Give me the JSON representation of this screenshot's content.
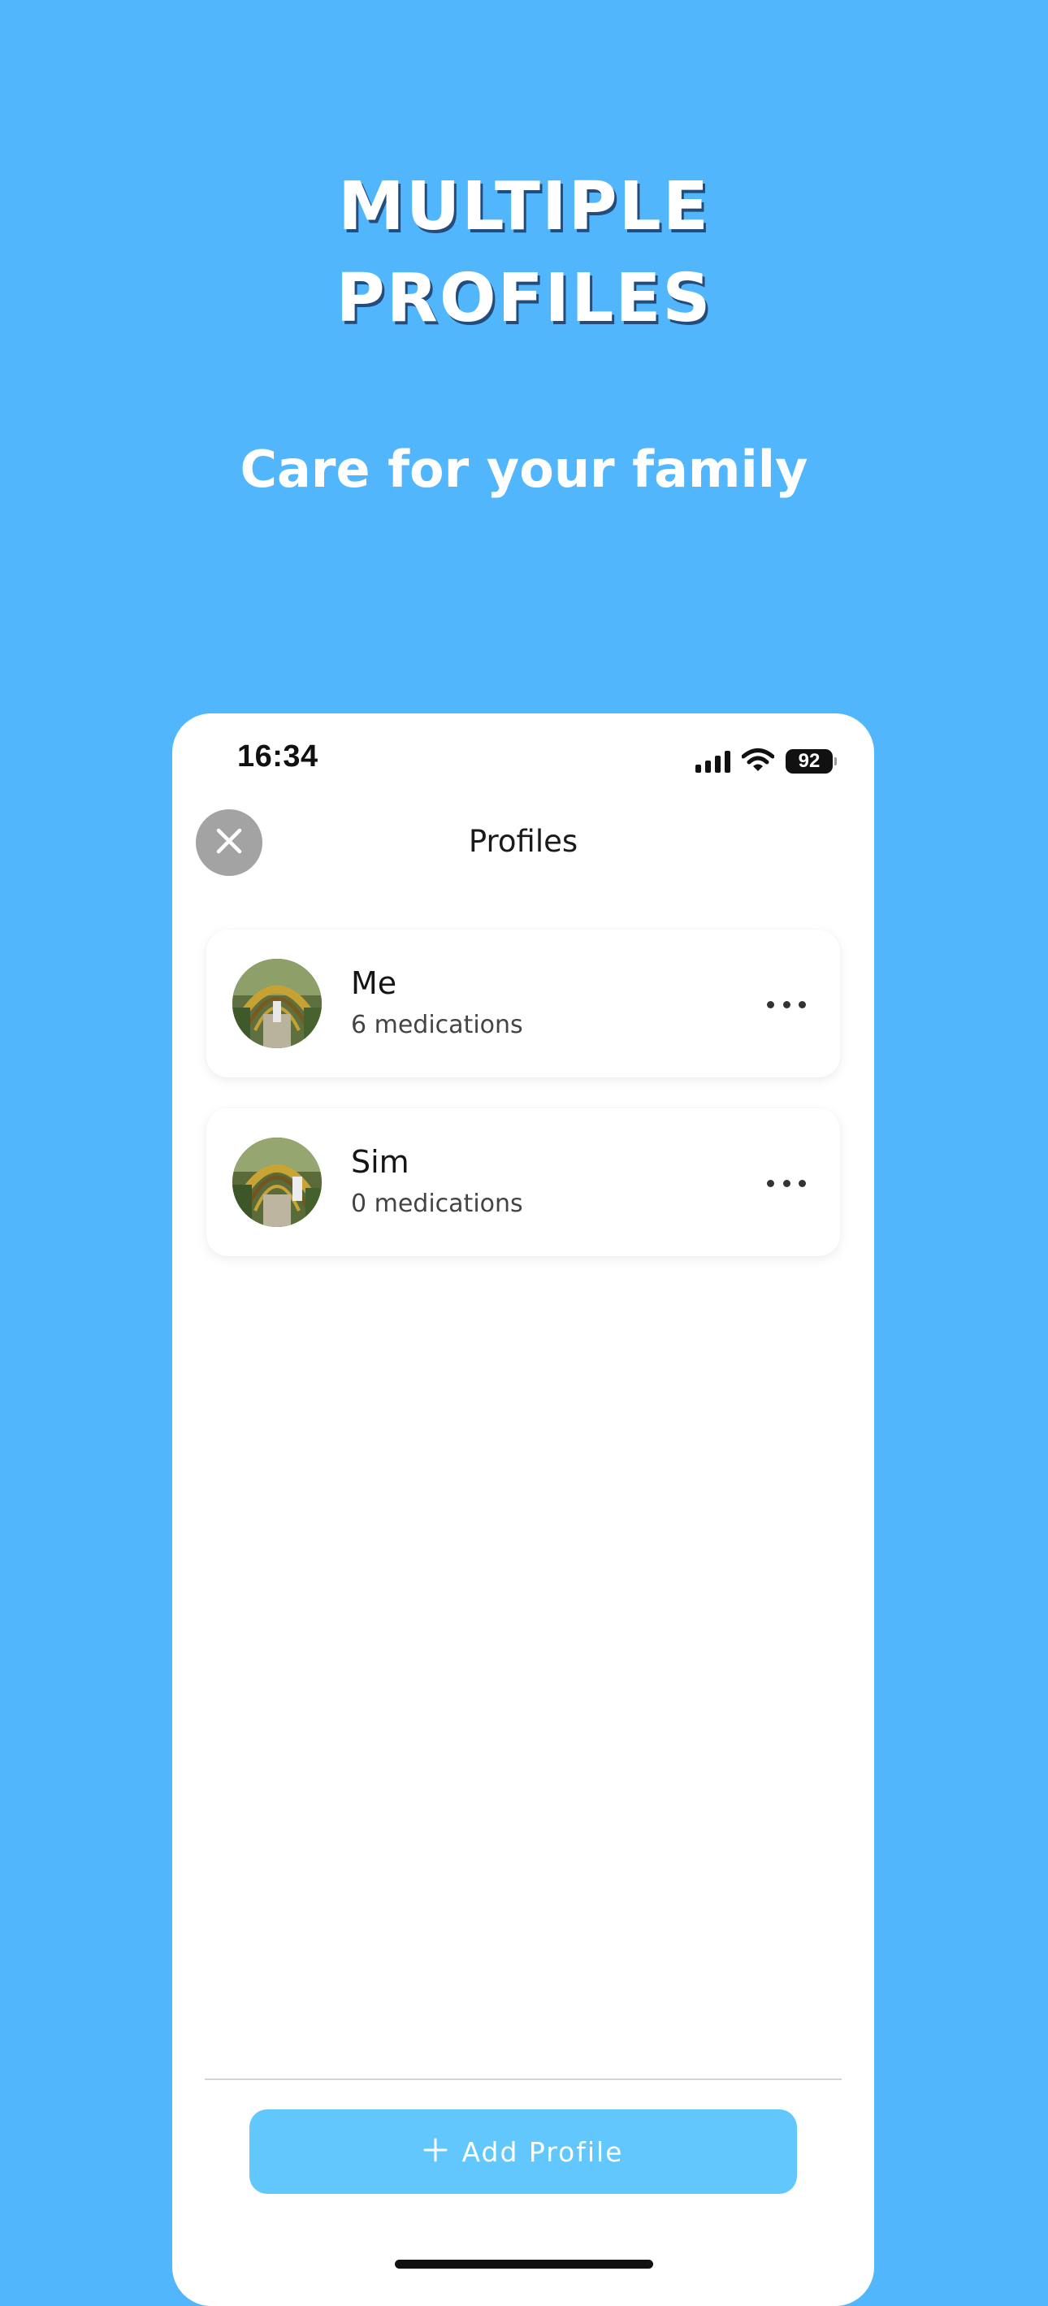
{
  "hero": {
    "title_line1": "MULTIPLE",
    "title_line2": "PROFILES",
    "subtitle": "Care for your family"
  },
  "status_bar": {
    "time": "16:34",
    "battery": "92",
    "icons": [
      "signal-icon",
      "wifi-icon",
      "battery-icon"
    ]
  },
  "header": {
    "title": "Profiles",
    "close_icon": "close-icon"
  },
  "profiles": [
    {
      "name": "Me",
      "medications": "6 medications",
      "more_icon": "more-icon"
    },
    {
      "name": "Sim",
      "medications": "0 medications",
      "more_icon": "more-icon"
    }
  ],
  "footer": {
    "add_label": "Add Profile",
    "add_icon": "plus-icon"
  },
  "colors": {
    "background": "#52b6fd",
    "add_button": "#62c7fc",
    "close_button": "#a3a3a3"
  }
}
